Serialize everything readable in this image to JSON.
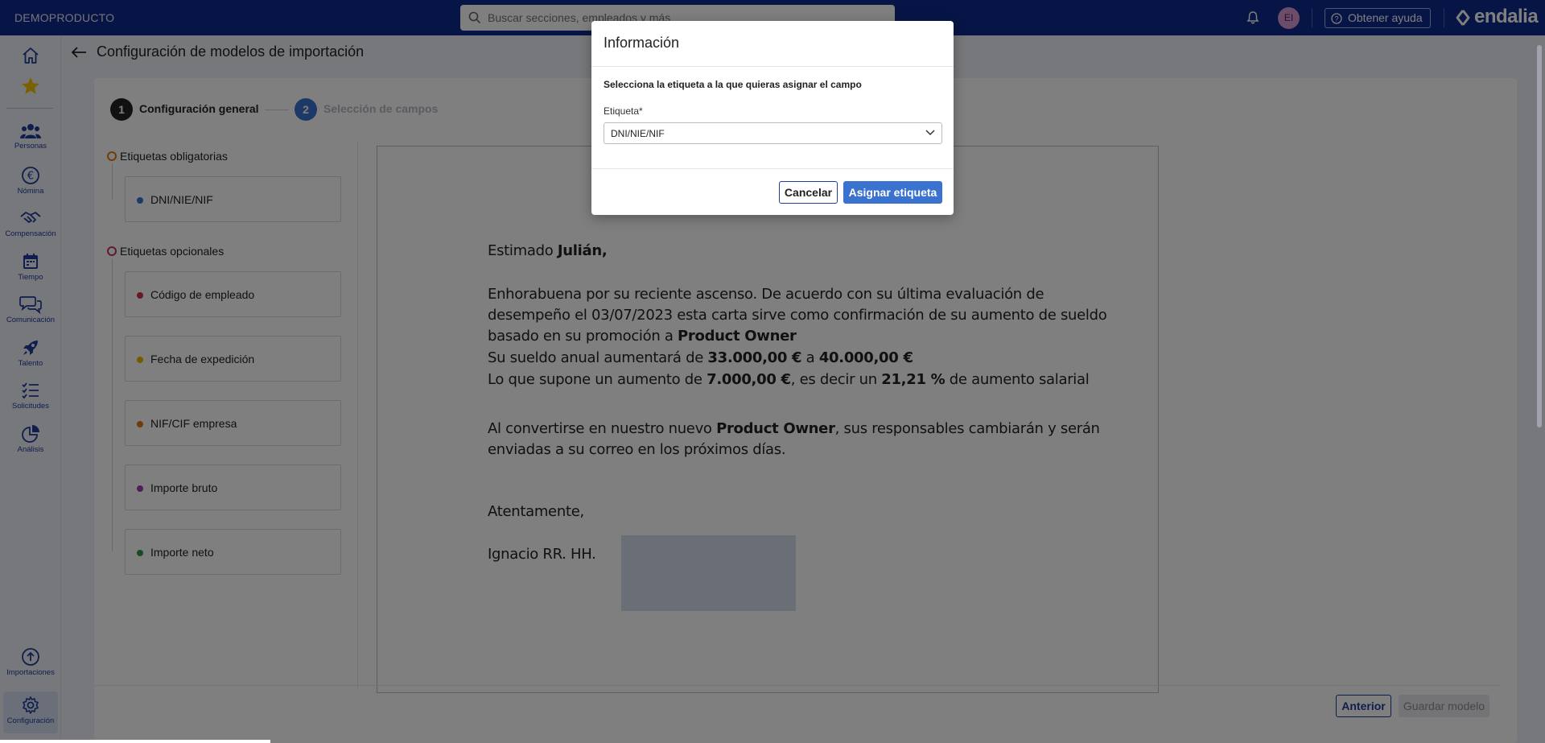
{
  "topbar": {
    "company": "DEMOPRODUCTO",
    "search_placeholder": "Buscar secciones, empleados y más",
    "avatar_initials": "EI",
    "help_label": "Obtener ayuda",
    "logo_text": "endalia"
  },
  "sidebar": {
    "items": [
      {
        "label": "",
        "icon": "home-icon"
      },
      {
        "label": "",
        "icon": "star-icon"
      },
      {
        "label": "Personas",
        "icon": "people-icon"
      },
      {
        "label": "Nómina",
        "icon": "euro-icon"
      },
      {
        "label": "Compensación",
        "icon": "handshake-icon"
      },
      {
        "label": "Tiempo",
        "icon": "calendar-icon"
      },
      {
        "label": "Comunicación",
        "icon": "chat-icon"
      },
      {
        "label": "Talento",
        "icon": "rocket-icon"
      },
      {
        "label": "Solicitudes",
        "icon": "checklist-icon"
      },
      {
        "label": "Análisis",
        "icon": "pie-chart-icon"
      },
      {
        "label": "Importaciones",
        "icon": "upload-icon"
      },
      {
        "label": "Configuración",
        "icon": "gear-icon"
      }
    ]
  },
  "page": {
    "title": "Configuración de modelos de importación"
  },
  "steps": [
    {
      "number": "1",
      "label": "Configuración general"
    },
    {
      "number": "2",
      "label": "Selección de campos"
    }
  ],
  "tags": {
    "mandatory_title": "Etiquetas obligatorias",
    "mandatory": [
      {
        "name": "DNI/NIE/NIF",
        "color": "#3a72d0"
      }
    ],
    "optional_title": "Etiquetas opcionales",
    "optional": [
      {
        "name": "Código de empleado",
        "color": "#d0334a"
      },
      {
        "name": "Fecha de expedición",
        "color": "#e8b400"
      },
      {
        "name": "NIF/CIF empresa",
        "color": "#e07a10"
      },
      {
        "name": "Importe bruto",
        "color": "#9a3bb8"
      },
      {
        "name": "Importe neto",
        "color": "#2e9a48"
      }
    ]
  },
  "document": {
    "greeting_prefix": "Estimado ",
    "greeting_name": "Julián,",
    "p1_line1": "Enhorabuena por su reciente ascenso. De acuerdo con su última evaluación de",
    "p1_line2": "desempeño el 03/07/2023 esta carta sirve como confirmación de su aumento de sueldo",
    "p1_line3_prefix": "basado en su promoción a ",
    "p1_line3_role": "Product Owner",
    "p1_line4_a": "Su sueldo anual aumentará de ",
    "p1_line4_from": "33.000,00 €",
    "p1_line4_b": " a ",
    "p1_line4_to": "40.000,00 €",
    "p1_line5_a": "Lo que supone un aumento de ",
    "p1_line5_amount": "7.000,00 €",
    "p1_line5_b": ", es decir un ",
    "p1_line5_pct": "21,21 %",
    "p1_line5_c": " de aumento salarial",
    "p2_line1_a": "Al convertirse en nuestro nuevo ",
    "p2_line1_role": "Product Owner",
    "p2_line1_b": ", sus responsables cambiarán y serán",
    "p2_line2": "enviadas a su correo en los próximos días.",
    "closing": "Atentamente,",
    "signer": "Ignacio RR. HH."
  },
  "footer": {
    "prev_label": "Anterior",
    "save_label": "Guardar modelo"
  },
  "modal": {
    "title": "Información",
    "instruction": "Selecciona la etiqueta a la que quieras asignar el campo",
    "field_label": "Etiqueta*",
    "selected_value": "DNI/NIE/NIF",
    "cancel_label": "Cancelar",
    "assign_label": "Asignar etiqueta"
  },
  "colors": {
    "topbar": "#0d2a8a",
    "primary": "#3a72d0",
    "nav": "#1f3d99"
  }
}
